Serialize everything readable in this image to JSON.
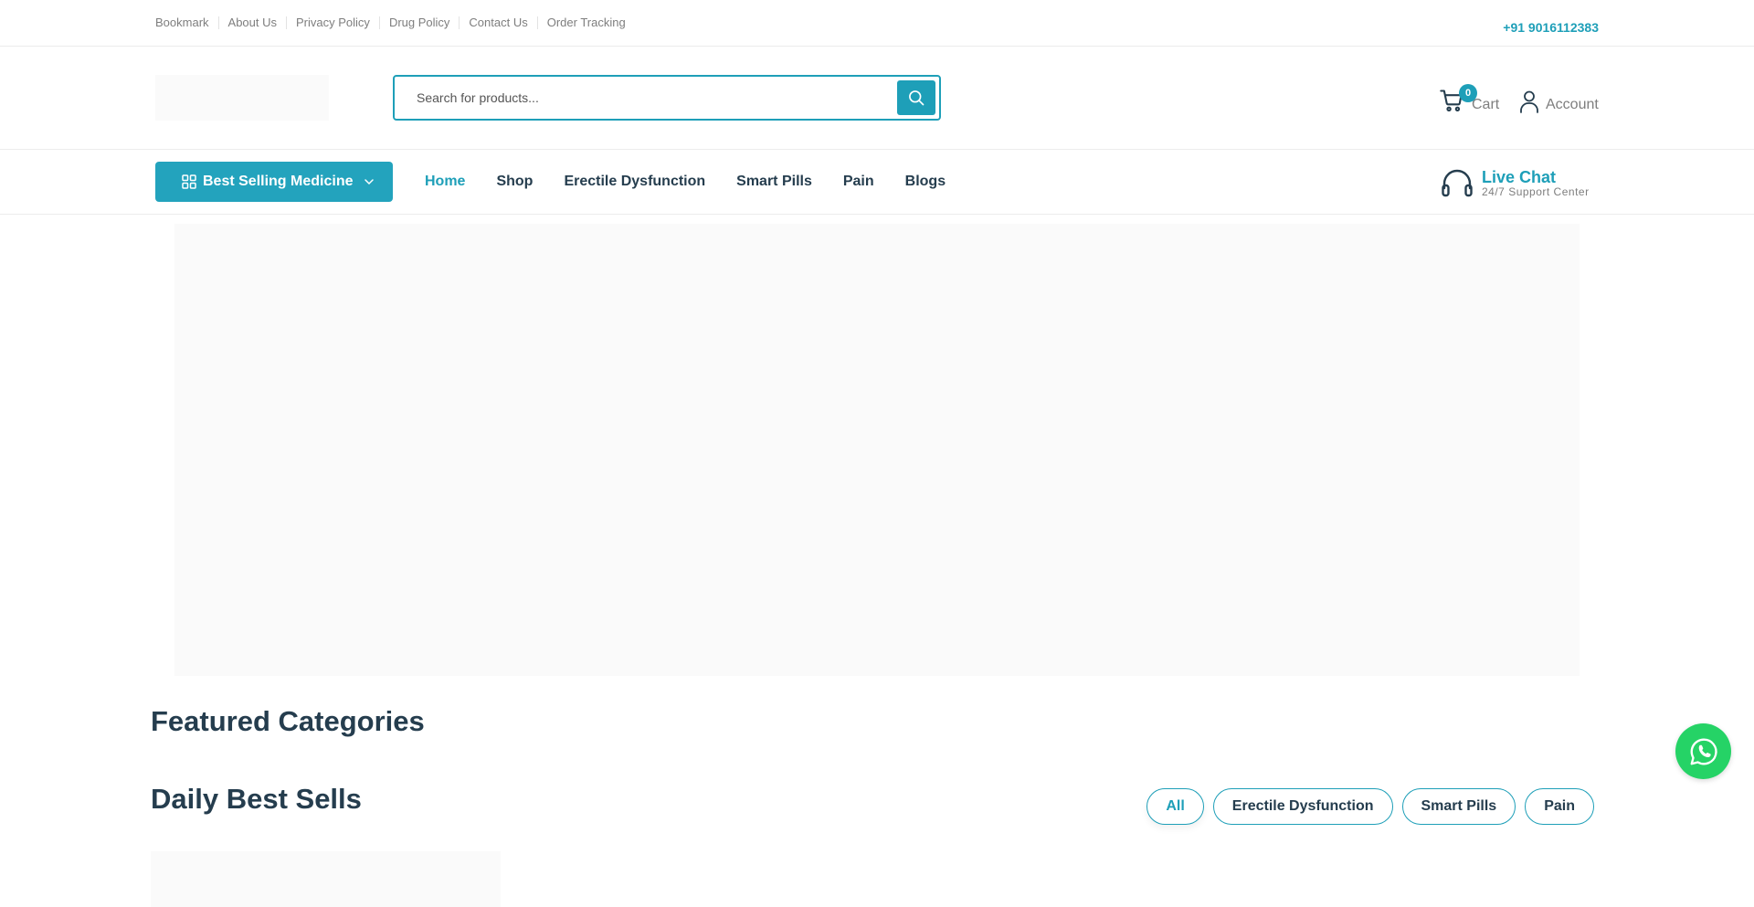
{
  "topbar": {
    "links": [
      "Bookmark",
      "About Us",
      "Privacy Policy",
      "Drug Policy",
      "Contact Us",
      "Order Tracking"
    ],
    "phone": "+91 9016112383"
  },
  "header": {
    "search_placeholder": "Search for products...",
    "cart_count": "0",
    "cart_label": "Cart",
    "account_label": "Account"
  },
  "nav": {
    "category_button": "Best Selling Medicine",
    "menu": [
      "Home",
      "Shop",
      "Erectile Dysfunction",
      "Smart Pills",
      "Pain",
      "Blogs"
    ],
    "active_menu": "Home",
    "live_chat_title": "Live Chat",
    "live_chat_sub": "24/7 Support Center"
  },
  "sections": {
    "featured_title": "Featured Categories",
    "daily_title": "Daily Best Sells",
    "filters": [
      "All",
      "Erectile Dysfunction",
      "Smart Pills",
      "Pain"
    ],
    "active_filter": "All"
  },
  "colors": {
    "accent": "#1e9fb8",
    "heading": "#253d4e",
    "whatsapp": "#25d366"
  }
}
